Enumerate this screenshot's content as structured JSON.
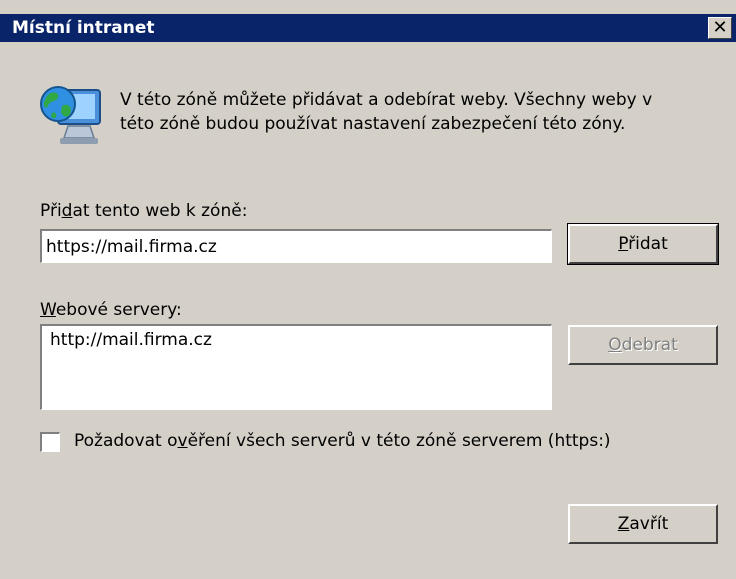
{
  "window": {
    "title": "Místní intranet",
    "close_glyph": "✕"
  },
  "info": {
    "icon": "computer-globe-icon",
    "text_line1": "V této zóně můžete přidávat a odebírat weby. Všechny weby v",
    "text_line2": "této zóně budou používat nastavení zabezpečení této zóny."
  },
  "add_site": {
    "label_pre": "Při",
    "label_key": "d",
    "label_post": "at tento web k zóně:",
    "value": "https://mail.firma.cz",
    "button_key": "P",
    "button_post": "řidat"
  },
  "servers": {
    "label_key": "W",
    "label_post": "ebové servery:",
    "items": [
      "http://mail.firma.cz"
    ],
    "remove_key": "O",
    "remove_post": "debrat"
  },
  "require_https": {
    "checked": false,
    "label_pre": "Požadovat o",
    "label_key": "v",
    "label_post": "ěření všech serverů v této zóně serverem (https:)"
  },
  "footer": {
    "close_key": "Z",
    "close_post": "avřít"
  }
}
